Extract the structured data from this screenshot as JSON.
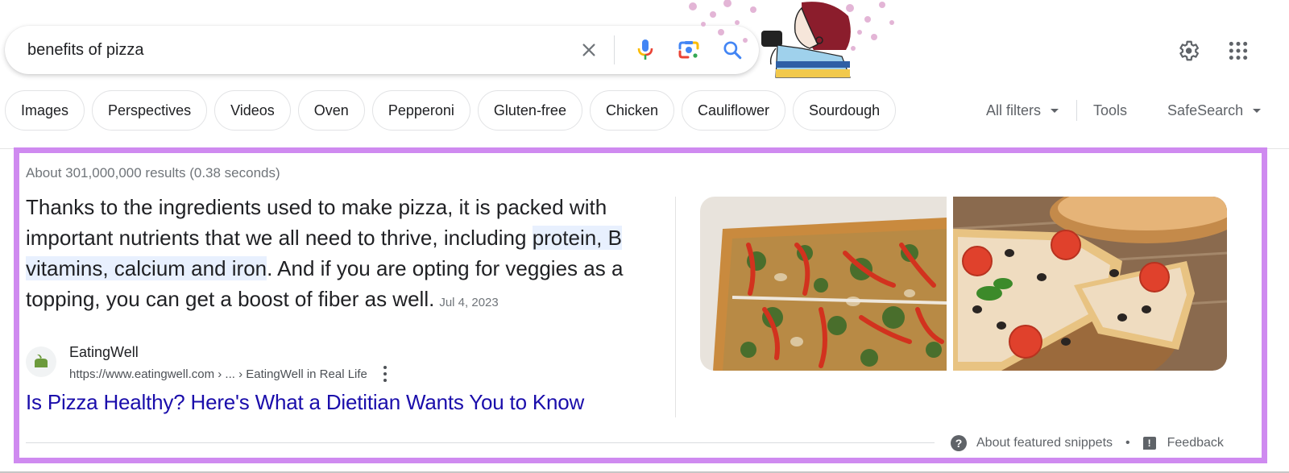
{
  "search": {
    "query": "benefits of pizza",
    "clear_icon": "close-icon",
    "mic_icon": "microphone-icon",
    "lens_icon": "google-lens-icon",
    "search_icon": "search-icon"
  },
  "header": {
    "doodle": "google-doodle",
    "settings_icon": "gear-icon",
    "apps_icon": "apps-grid-icon"
  },
  "chips": [
    {
      "label": "Images"
    },
    {
      "label": "Perspectives"
    },
    {
      "label": "Videos"
    },
    {
      "label": "Oven"
    },
    {
      "label": "Pepperoni"
    },
    {
      "label": "Gluten-free"
    },
    {
      "label": "Chicken"
    },
    {
      "label": "Cauliflower"
    },
    {
      "label": "Sourdough"
    }
  ],
  "filters": {
    "all_filters": "All filters",
    "tools": "Tools",
    "safesearch": "SafeSearch"
  },
  "results": {
    "stats": "About 301,000,000 results (0.38 seconds)"
  },
  "snippet": {
    "text_before": "Thanks to the ingredients used to make pizza, it is packed with important nutrients that we all need to thrive, including ",
    "highlight": "protein, B vitamins, calcium and iron",
    "text_after": ". And if you are opting for veggies as a topping, you can get a boost of fiber as well.",
    "date": "Jul 4, 2023",
    "source_name": "EatingWell",
    "source_url": "https://www.eatingwell.com › ... › EatingWell in Real Life",
    "title": "Is Pizza Healthy? Here's What a Dietitian Wants You to Know",
    "images": [
      {
        "alt": "Rectangular veggie pizza with red peppers and spinach"
      },
      {
        "alt": "Round pizza with tomatoes, olives and basil"
      }
    ],
    "highlight_color": "#e8f0fe",
    "outline_color": "#cf8af0"
  },
  "footer": {
    "about": "About featured snippets",
    "separator": "•",
    "feedback": "Feedback"
  },
  "colors": {
    "link": "#1a0dab",
    "secondary_text": "#5f6368",
    "blue": "#4285f4",
    "red": "#ea4335",
    "yellow": "#fbbc05",
    "green": "#34a853"
  }
}
